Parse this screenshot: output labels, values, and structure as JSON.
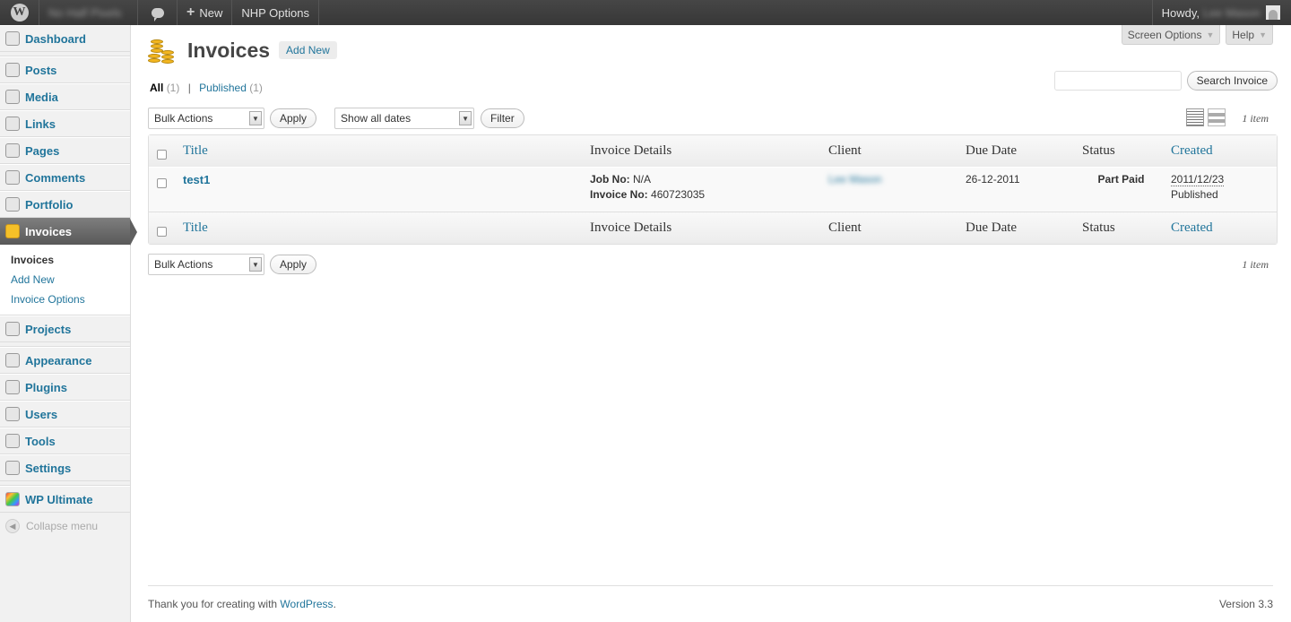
{
  "adminbar": {
    "site_name": "No Half Pixels",
    "new_label": "New",
    "options_label": "NHP Options",
    "howdy_prefix": "Howdy,",
    "user_name": "Lee Mason"
  },
  "sidebar": {
    "items": [
      {
        "label": "Dashboard",
        "icon": "dashboard-icon"
      },
      {
        "label": "Posts",
        "icon": "posts-icon"
      },
      {
        "label": "Media",
        "icon": "media-icon"
      },
      {
        "label": "Links",
        "icon": "links-icon"
      },
      {
        "label": "Pages",
        "icon": "pages-icon"
      },
      {
        "label": "Comments",
        "icon": "comments-icon"
      },
      {
        "label": "Portfolio",
        "icon": "portfolio-icon"
      },
      {
        "label": "Invoices",
        "icon": "invoices-icon"
      },
      {
        "label": "Projects",
        "icon": "projects-icon"
      },
      {
        "label": "Appearance",
        "icon": "appearance-icon"
      },
      {
        "label": "Plugins",
        "icon": "plugins-icon"
      },
      {
        "label": "Users",
        "icon": "users-icon"
      },
      {
        "label": "Tools",
        "icon": "tools-icon"
      },
      {
        "label": "Settings",
        "icon": "settings-icon"
      },
      {
        "label": "WP Ultimate",
        "icon": "wp-ultimate-icon"
      }
    ],
    "submenu": [
      "Invoices",
      "Add New",
      "Invoice Options"
    ],
    "collapse_label": "Collapse menu"
  },
  "screen_meta": {
    "screen_options": "Screen Options",
    "help": "Help"
  },
  "header": {
    "title": "Invoices",
    "add_new": "Add New"
  },
  "views": {
    "all": "All",
    "all_count": "(1)",
    "published": "Published",
    "published_count": "(1)"
  },
  "search": {
    "button": "Search Invoice"
  },
  "tablenav": {
    "bulk_actions": "Bulk Actions",
    "apply": "Apply",
    "dates": "Show all dates",
    "filter": "Filter",
    "count": "1 item"
  },
  "table": {
    "columns": [
      "Title",
      "Invoice Details",
      "Client",
      "Due Date",
      "Status",
      "Created"
    ],
    "rows": [
      {
        "title": "test1",
        "job_label": "Job No:",
        "job_value": "N/A",
        "invoice_label": "Invoice No:",
        "invoice_value": "460723035",
        "client": "Lee Mason",
        "due_date": "26-12-2011",
        "status": "Part Paid",
        "created_date": "2011/12/23",
        "created_status": "Published"
      }
    ]
  },
  "footer": {
    "thanks_prefix": "Thank you for creating with",
    "wordpress": "WordPress",
    "period": ".",
    "version": "Version 3.3"
  },
  "colors": {
    "link": "#21759b",
    "status_part_paid": "#f29b13",
    "adminbar": "#464646"
  }
}
